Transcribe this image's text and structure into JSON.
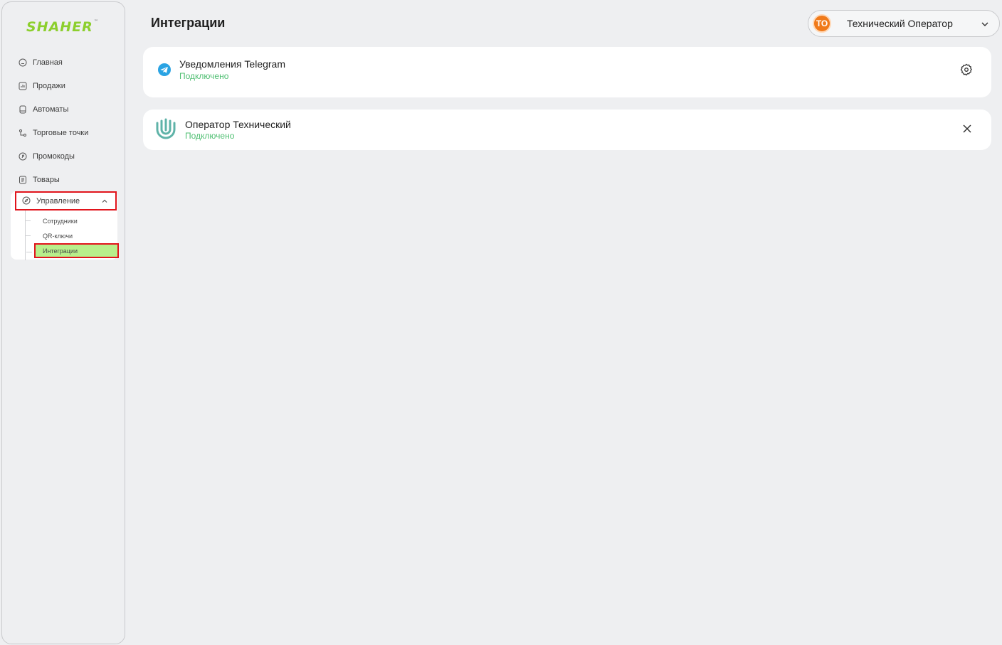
{
  "brand": {
    "logo_text": "SHAHER",
    "trademark": "™"
  },
  "sidebar": {
    "items": [
      {
        "label": "Главная",
        "icon": "home-icon"
      },
      {
        "label": "Продажи",
        "icon": "chart-icon"
      },
      {
        "label": "Автоматы",
        "icon": "machine-icon"
      },
      {
        "label": "Торговые точки",
        "icon": "points-icon"
      },
      {
        "label": "Промокоды",
        "icon": "tag-icon"
      },
      {
        "label": "Товары",
        "icon": "list-icon"
      }
    ],
    "group": {
      "label": "Управление",
      "icon": "compass-icon",
      "expanded": true,
      "sub_items": [
        {
          "label": "Сотрудники"
        },
        {
          "label": "QR-ключи"
        },
        {
          "label": "Интеграции",
          "active": true
        }
      ]
    }
  },
  "header": {
    "title": "Интеграции",
    "user": {
      "initials": "ТО",
      "name": "Технический Оператор"
    }
  },
  "integrations": [
    {
      "title": "Уведомления Telegram",
      "status": "Подключено",
      "icon": "telegram-icon",
      "action": "settings-icon"
    },
    {
      "title": "Оператор Технический",
      "status": "Подключено",
      "icon": "operator-logo-icon",
      "action": "close-icon"
    }
  ],
  "colors": {
    "accent_green": "#8ccf2d",
    "status_green": "#4fbf72",
    "active_bg": "#b8ef8b",
    "highlight_red": "#e1141c",
    "avatar_orange": "#f07a1a"
  }
}
